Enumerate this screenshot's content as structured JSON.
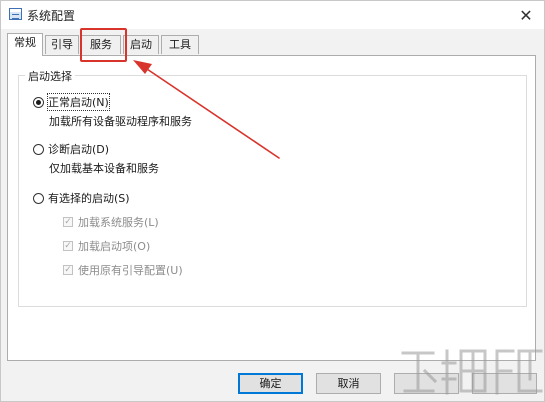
{
  "window": {
    "title": "系统配置",
    "close_glyph": "✕"
  },
  "tabs": [
    {
      "label": "常规",
      "active": true
    },
    {
      "label": "引导",
      "active": false
    },
    {
      "label": "服务",
      "active": false,
      "highlighted": true
    },
    {
      "label": "启动",
      "active": false
    },
    {
      "label": "工具",
      "active": false
    }
  ],
  "startup_group": {
    "legend": "启动选择",
    "normal": {
      "label": "正常启动(N)",
      "description": "加载所有设备驱动程序和服务",
      "selected": true
    },
    "diagnostic": {
      "label": "诊断启动(D)",
      "description": "仅加载基本设备和服务",
      "selected": false
    },
    "selective": {
      "label": "有选择的启动(S)",
      "selected": false,
      "options": [
        {
          "label": "加载系统服务(L)",
          "checked": true,
          "enabled": false
        },
        {
          "label": "加载启动项(O)",
          "checked": true,
          "enabled": false
        },
        {
          "label": "使用原有引导配置(U)",
          "checked": true,
          "enabled": false
        }
      ]
    }
  },
  "footer": {
    "ok_label": "确定",
    "cancel_label": "取消"
  },
  "annotation": {
    "highlight_color": "#d9342b",
    "arrow_color": "#d9342b"
  }
}
